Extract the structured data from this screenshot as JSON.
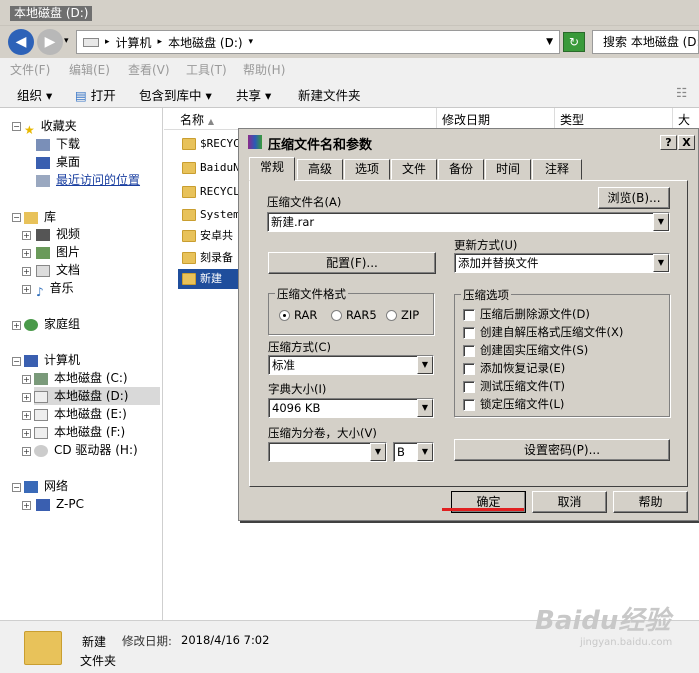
{
  "window": {
    "title": "本地磁盘 (D:)"
  },
  "address": {
    "path": [
      "计算机",
      "本地磁盘 (D:)"
    ],
    "search_placeholder": "搜索 本地磁盘 (D:)"
  },
  "menu": [
    "文件(F)",
    "编辑(E)",
    "查看(V)",
    "工具(T)",
    "帮助(H)"
  ],
  "toolbar": {
    "organize": "组织",
    "open": "打开",
    "include": "包含到库中",
    "share": "共享",
    "new_folder": "新建文件夹"
  },
  "nav": {
    "favorites": "收藏夹",
    "downloads": "下载",
    "desktop": "桌面",
    "recent": "最近访问的位置",
    "libraries": "库",
    "videos": "视频",
    "pictures": "图片",
    "documents": "文档",
    "music": "音乐",
    "homegroup": "家庭组",
    "computer": "计算机",
    "drive_c": "本地磁盘 (C:)",
    "drive_d": "本地磁盘 (D:)",
    "drive_e": "本地磁盘 (E:)",
    "drive_f": "本地磁盘 (F:)",
    "drive_h": "CD 驱动器 (H:)",
    "network": "网络",
    "zpc": "Z-PC"
  },
  "columns": {
    "name": "名称",
    "modified": "修改日期",
    "type": "类型",
    "size": "大小"
  },
  "files": [
    "$RECYCL",
    "BaiduN",
    "RECYCLI",
    "System",
    "安卓共",
    "刻录备",
    "新建"
  ],
  "details": {
    "name": "新建",
    "modified_label": "修改日期:",
    "modified": "2018/4/16 7:02",
    "type": "文件夹"
  },
  "dialog": {
    "title": "压缩文件名和参数",
    "help_btn": "?",
    "close_btn": "X",
    "tabs": [
      "常规",
      "高级",
      "选项",
      "文件",
      "备份",
      "时间",
      "注释"
    ],
    "archive_name_label": "压缩文件名(A)",
    "archive_name": "新建.rar",
    "browse": "浏览(B)...",
    "update_label": "更新方式(U)",
    "update_value": "添加并替换文件",
    "profiles": "配置(F)...",
    "format_label": "压缩文件格式",
    "formats": [
      "RAR",
      "RAR5",
      "ZIP"
    ],
    "method_label": "压缩方式(C)",
    "method_value": "标准",
    "dict_label": "字典大小(I)",
    "dict_value": "4096 KB",
    "split_label": "压缩为分卷，大小(V)",
    "split_value": "",
    "split_unit": "B",
    "options_label": "压缩选项",
    "options": [
      "压缩后删除源文件(D)",
      "创建自解压格式压缩文件(X)",
      "创建固实压缩文件(S)",
      "添加恢复记录(E)",
      "测试压缩文件(T)",
      "锁定压缩文件(L)"
    ],
    "password": "设置密码(P)...",
    "ok": "确定",
    "cancel": "取消",
    "help": "帮助"
  },
  "watermark": {
    "main": "Baidu经验",
    "sub": "jingyan.baidu.com"
  }
}
